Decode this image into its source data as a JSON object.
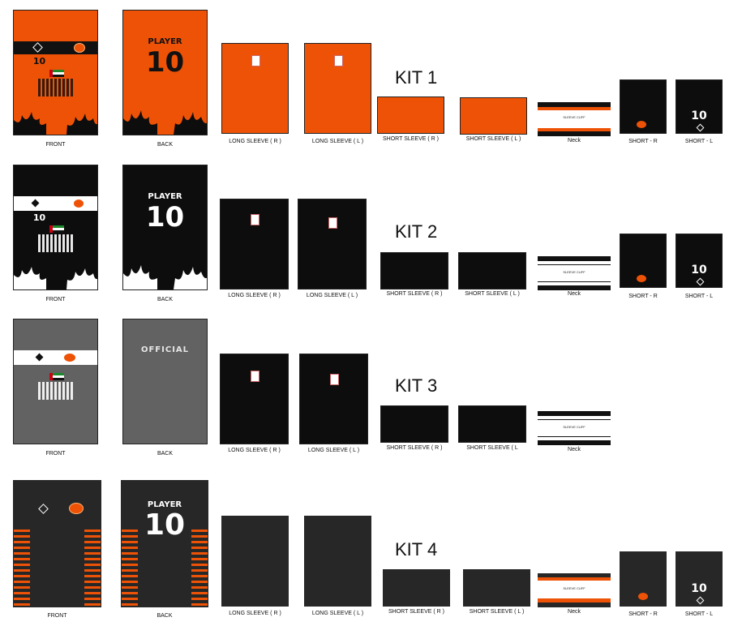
{
  "kits": [
    {
      "title": "KIT 1",
      "number": "10",
      "player": "PLAYER"
    },
    {
      "title": "KIT 2",
      "number": "10",
      "player": "PLAYER"
    },
    {
      "title": "KIT 3",
      "official": "OFFICIAL"
    },
    {
      "title": "KIT 4",
      "number": "10",
      "player": "PLAYER"
    }
  ],
  "captions": {
    "front": "FRONT",
    "back": "BACK",
    "long_r": "LONG SLEEVE ( R )",
    "long_l": "LONG SLEEVE ( L )",
    "short_r": "SHORT SLEEVE ( R )",
    "short_l": "SHORT SLEEVE ( L )",
    "short_l_k3": "SHORT SLEEVE ( L",
    "neck": "Neck",
    "shorts_r": "SHORT - R",
    "shorts_l": "SHORT - L",
    "sleeve_cuff": "SLEEVE CUFF"
  },
  "colors": {
    "orange": "#ee5206",
    "black": "#0d0d0d",
    "grey": "#626262",
    "charcoal": "#272727",
    "white": "#ffffff"
  },
  "icons": {
    "brand_logo": "diamond-logo-icon",
    "sponsor_logo": "flame-ball-logo-icon",
    "flag": "flag-icon"
  }
}
